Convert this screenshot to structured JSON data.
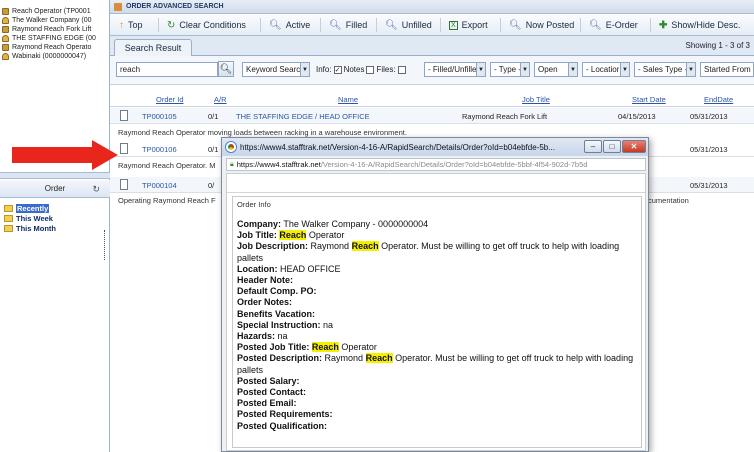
{
  "recent_items": [
    {
      "label": "Reach Operator (TP0001",
      "icon": "order-icon"
    },
    {
      "label": "The Walker Company (00",
      "icon": "company-icon"
    },
    {
      "label": "Raymond Reach Fork Lift",
      "icon": "order-icon"
    },
    {
      "label": "THE STAFFING EDGE (00",
      "icon": "company-icon"
    },
    {
      "label": "Raymond Reach Operato",
      "icon": "order-icon"
    },
    {
      "label": "Wabinaki (0000000047)",
      "icon": "company-icon"
    }
  ],
  "order_panel": {
    "title": "Order",
    "tree": [
      {
        "label": "Recently",
        "selected": true
      },
      {
        "label": "This Week",
        "selected": false
      },
      {
        "label": "This Month",
        "selected": false
      }
    ]
  },
  "header": {
    "title": "ORDER ADVANCED SEARCH"
  },
  "toolbar": {
    "top": "Top",
    "clear": "Clear Conditions",
    "active": "Active",
    "filled": "Filled",
    "unfilled": "Unfilled",
    "export": "Export",
    "now_posted": "Now Posted",
    "eorder": "E-Order",
    "show_hide": "Show/Hide Desc."
  },
  "tab": {
    "label": "Search Result",
    "showing": "Showing 1 - 3 of 3"
  },
  "filters": {
    "search_value": "reach",
    "keyword_search": "Keyword Search",
    "info": "Info:",
    "notes": "Notes",
    "files": "Files:",
    "filled_unfilled": "- Filled/Unfille",
    "type": "- Type -",
    "status": "Open",
    "location": "- Locatior",
    "sales_type": "- Sales Type -",
    "started_from": "Started From"
  },
  "grid": {
    "columns": {
      "order_id": "Order Id",
      "ar": "A/R",
      "name": "Name",
      "job_title": "Job Title",
      "start_date": "Start Date",
      "end_date": "EndDate"
    },
    "rows": [
      {
        "order_id": "TP000105",
        "ar": "0/1",
        "name": "THE STAFFING EDGE / HEAD OFFICE",
        "job_title": "Raymond Reach Fork Lift",
        "start_date": "04/15/2013",
        "end_date": "05/31/2013",
        "desc": "Raymond Reach Operator moving loads between racking in a warehouse environment."
      },
      {
        "order_id": "TP000106",
        "ar": "0/1",
        "name": "",
        "job_title": "",
        "start_date": "",
        "end_date": "05/31/2013",
        "desc": "Raymond Reach Operator.  M"
      },
      {
        "order_id": "TP000104",
        "ar": "0/",
        "name": "",
        "job_title": "",
        "start_date": "",
        "end_date": "05/31/2013",
        "desc": "Operating Raymond Reach F",
        "desc_tail": "cumentation"
      }
    ]
  },
  "popup": {
    "title": "https://www4.stafftrak.net/Version-4-16-A/RapidSearch/Details/Order?oId=b04ebfde-5b...",
    "url_host": "https://www4.stafftrak.net",
    "url_rest": "/Version-4-16-A/RapidSearch/Details/Order?oId=b04ebfde-5bbf-4f54-902d-7b5d",
    "section_title": "Order Info",
    "fields": {
      "company_label": "Company:",
      "company_value": "The Walker Company - 0000000004",
      "job_title_label": "Job Title:",
      "job_title_hl": "Reach",
      "job_title_rest": "Operator",
      "job_desc_label": "Job Description:",
      "job_desc_pre": "Raymond",
      "job_desc_hl": "Reach",
      "job_desc_post": "Operator.  Must be willing to get off truck to help with loading pallets",
      "location_label": "Location:",
      "location_value": "HEAD OFFICE",
      "header_note_label": "Header Note:",
      "default_po_label": "Default Comp. PO:",
      "order_notes_label": "Order Notes:",
      "benefits_label": "Benefits Vacation:",
      "special_label": "Special Instruction:",
      "special_value": "na",
      "hazards_label": "Hazards:",
      "hazards_value": "na",
      "posted_job_title_label": "Posted Job Title:",
      "posted_job_title_hl": "Reach",
      "posted_job_title_rest": "Operator",
      "posted_desc_label": "Posted Description:",
      "posted_desc_pre": "Raymond",
      "posted_desc_hl": "Reach",
      "posted_desc_post": "Operator.  Must be willing to get off truck to help with loading pallets",
      "posted_salary_label": "Posted Salary:",
      "posted_contact_label": "Posted Contact:",
      "posted_email_label": "Posted Email:",
      "posted_req_label": "Posted Requirements:",
      "posted_qual_label": "Posted Qualification:"
    }
  },
  "colors": {
    "accent_red": "#e8261c",
    "highlight": "#f5f000",
    "link": "#2b56a6"
  }
}
